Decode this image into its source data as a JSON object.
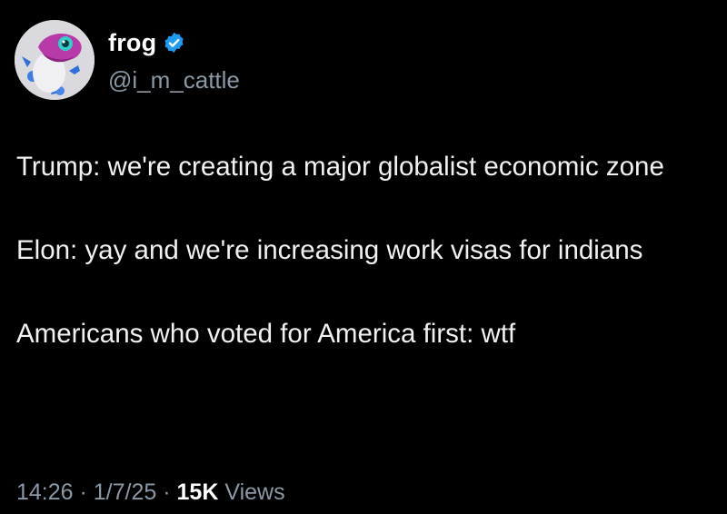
{
  "author": {
    "display_name": "frog",
    "handle": "@i_m_cattle",
    "verified": true,
    "verified_color": "#1d9bf0",
    "avatar_icon": "frog-avatar-icon"
  },
  "tweet": {
    "paragraphs": [
      "Trump: we're creating a major globalist economic zone",
      "Elon: yay and we're increasing work visas for indians",
      "Americans who voted for America first: wtf"
    ]
  },
  "meta": {
    "time": "14:26",
    "separator": " · ",
    "date": "1/7/25",
    "views_count": "15K",
    "views_label": "Views"
  },
  "colors": {
    "background": "#000000",
    "text": "#e7e9ea",
    "secondary": "#8b98a5"
  }
}
